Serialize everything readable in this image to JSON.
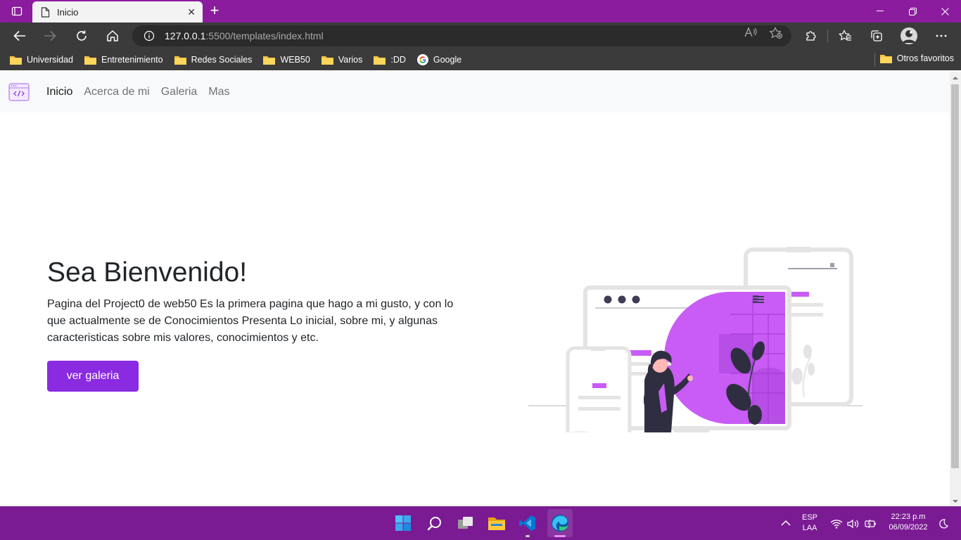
{
  "browser": {
    "tab_title": "Inicio",
    "url_host": "127.0.0.1",
    "url_path": ":5500/templates/index.html",
    "bookmarks": [
      "Universidad",
      "Entretenimiento",
      "Redes Sociales",
      "WEB50",
      "Varios",
      ":DD",
      "Google"
    ],
    "other_favorites": "Otros favoritos"
  },
  "site": {
    "nav": [
      "Inicio",
      "Acerca de mi",
      "Galeria",
      "Mas"
    ],
    "hero_title": "Sea Bienvenido!",
    "hero_text": "Pagina del Project0 de web50 Es la primera pagina que hago a mi gusto, y con lo que actualmente se de Conocimientos Presenta Lo inicial, sobre mi, y algunas caracteristicas sobre mis valores, conocimientos y etc.",
    "hero_button": "ver galeria",
    "accent": "#8a2be2"
  },
  "taskbar": {
    "lang": "ESP",
    "layout": "LAA",
    "time": "22:23 p.m",
    "date": "06/09/2022"
  },
  "colors": {
    "titlebar": "#8b1c9e",
    "toolbar": "#3b3b3b",
    "taskbar": "#7a1b93",
    "illustration_accent": "#c95cf5"
  }
}
